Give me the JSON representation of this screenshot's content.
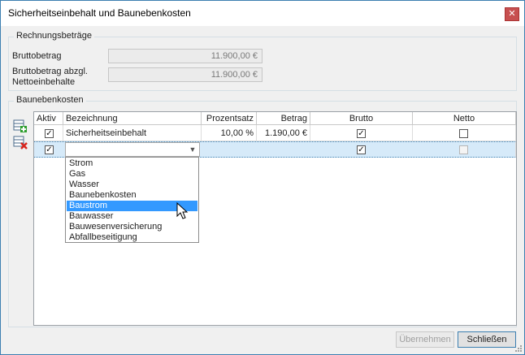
{
  "window": {
    "title": "Sicherheitseinbehalt und Baunebenkosten",
    "close_glyph": "✕"
  },
  "rechnung": {
    "group_label": "Rechnungsbeträge",
    "brutto_label": "Bruttobetrag",
    "brutto_value": "11.900,00 €",
    "netto_label_line1": "Bruttobetrag abzgl.",
    "netto_label_line2": "Nettoeinbehalte",
    "netto_value": "11.900,00 €"
  },
  "bauneben": {
    "group_label": "Baunebenkosten",
    "columns": [
      "Aktiv",
      "Bezeichnung",
      "Prozentsatz",
      "Betrag",
      "Brutto",
      "Netto"
    ],
    "rows": [
      {
        "aktiv": true,
        "bezeichnung": "Sicherheitseinbehalt",
        "prozentsatz": "10,00 %",
        "betrag": "1.190,00 €",
        "brutto": true,
        "netto": false
      },
      {
        "aktiv": true,
        "bezeichnung": "",
        "prozentsatz": "",
        "betrag": "",
        "brutto": true,
        "netto": false
      }
    ],
    "dropdown_options": [
      "Strom",
      "Gas",
      "Wasser",
      "Baunebenkosten",
      "Baustrom",
      "Bauwasser",
      "Bauwesenversicherung",
      "Abfallbeseitigung"
    ],
    "highlighted_option": "Baustrom",
    "icons": [
      "add-row-icon",
      "delete-row-icon"
    ]
  },
  "buttons": {
    "apply": "Übernehmen",
    "close": "Schließen"
  },
  "colors": {
    "highlight": "#3399ff",
    "selected_row": "#d6eaf9",
    "delete_red": "#d9241c",
    "add_green": "#2e9e2e"
  }
}
